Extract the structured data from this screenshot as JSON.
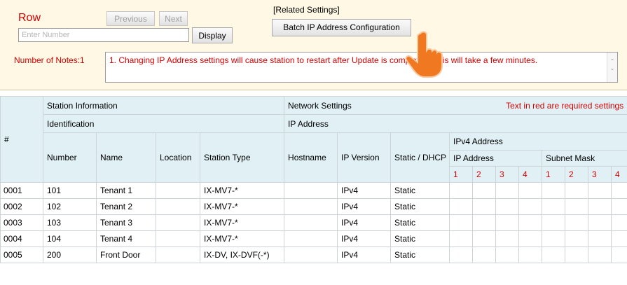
{
  "controls": {
    "row_label": "Row",
    "previous_label": "Previous",
    "next_label": "Next",
    "number_placeholder": "Enter Number",
    "display_label": "Display"
  },
  "related": {
    "label": "[Related Settings]",
    "batch_button": "Batch IP Address Configuration"
  },
  "notes": {
    "label": "Number of Notes:1",
    "text": "1. Changing IP Address settings will cause station to restart after Update is completed. This will take a few minutes."
  },
  "table": {
    "hash": "#",
    "station_info": "Station Information",
    "identification": "Identification",
    "network_settings": "Network Settings",
    "required_note": "Text in red are required settings",
    "ip_address_group": "IP Address",
    "ipv4_address": "IPv4 Address",
    "ip_address": "IP Address",
    "subnet_mask": "Subnet Mask",
    "columns": {
      "number": "Number",
      "name": "Name",
      "location": "Location",
      "station_type": "Station Type",
      "hostname": "Hostname",
      "ip_version": "IP Version",
      "static_dhcp": "Static / DHCP"
    },
    "octets": [
      "1",
      "2",
      "3",
      "4"
    ],
    "rows": [
      {
        "id": "0001",
        "number": "101",
        "name": "Tenant 1",
        "location": "",
        "type": "IX-MV7-*",
        "hostname": "",
        "ipver": "IPv4",
        "mode": "Static"
      },
      {
        "id": "0002",
        "number": "102",
        "name": "Tenant 2",
        "location": "",
        "type": "IX-MV7-*",
        "hostname": "",
        "ipver": "IPv4",
        "mode": "Static"
      },
      {
        "id": "0003",
        "number": "103",
        "name": "Tenant 3",
        "location": "",
        "type": "IX-MV7-*",
        "hostname": "",
        "ipver": "IPv4",
        "mode": "Static"
      },
      {
        "id": "0004",
        "number": "104",
        "name": "Tenant 4",
        "location": "",
        "type": "IX-MV7-*",
        "hostname": "",
        "ipver": "IPv4",
        "mode": "Static"
      },
      {
        "id": "0005",
        "number": "200",
        "name": "Front Door",
        "location": "",
        "type": "IX-DV, IX-DVF(-*)",
        "hostname": "",
        "ipver": "IPv4",
        "mode": "Static"
      }
    ]
  },
  "colors": {
    "panel_bg": "#fff8e4",
    "header_bg": "#e0f0f5",
    "required_red": "#d40000",
    "cursor_orange": "#f07820"
  }
}
